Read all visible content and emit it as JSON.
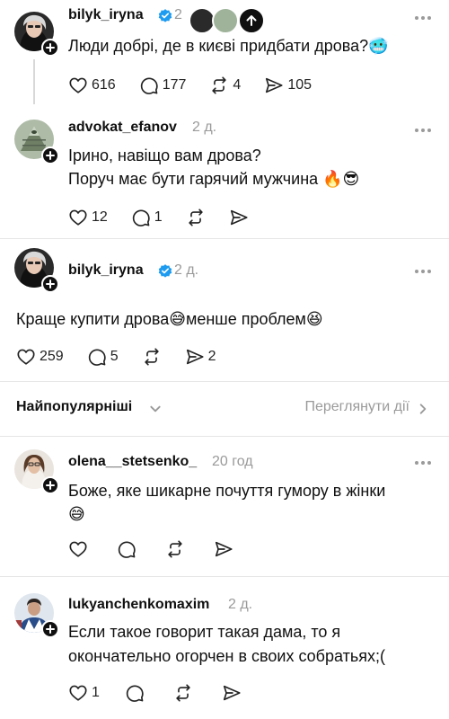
{
  "post1": {
    "username": "bilyk_iryna",
    "time": "2",
    "text": "Люди добрі, де в києві придбати дрова?🥶",
    "likes": "616",
    "comments": "177",
    "reposts": "4",
    "shares": "105"
  },
  "post2": {
    "username": "advokat_efanov",
    "time": "2 д.",
    "line1": "Ірино, навіщо вам дрова?",
    "line2": "Поруч має бути гарячий мужчина 🔥😎",
    "likes": "12",
    "comments": "1"
  },
  "post3": {
    "username": "bilyk_iryna",
    "time": "2 д.",
    "text": "Краще купити дрова😅менше проблем😆",
    "likes": "259",
    "comments": "5",
    "shares": "2"
  },
  "sortbar": {
    "label": "Найпопулярніші",
    "view_activity": "Переглянути дії"
  },
  "post4": {
    "username": "olena__stetsenko_",
    "time": "20 год",
    "line1": "Боже, яке шикарне почуття гумору в жінки",
    "line2": "😅"
  },
  "post5": {
    "username": "lukyanchenkomaxim",
    "time": "2 д.",
    "line1": "Если такое говорит такая дама, то я",
    "line2": "окончательно огорчен в своих собратьях;(",
    "likes": "1"
  },
  "colors": {
    "verified": "#1d9bf0",
    "muted": "#9a9a9a",
    "text": "#101010"
  }
}
